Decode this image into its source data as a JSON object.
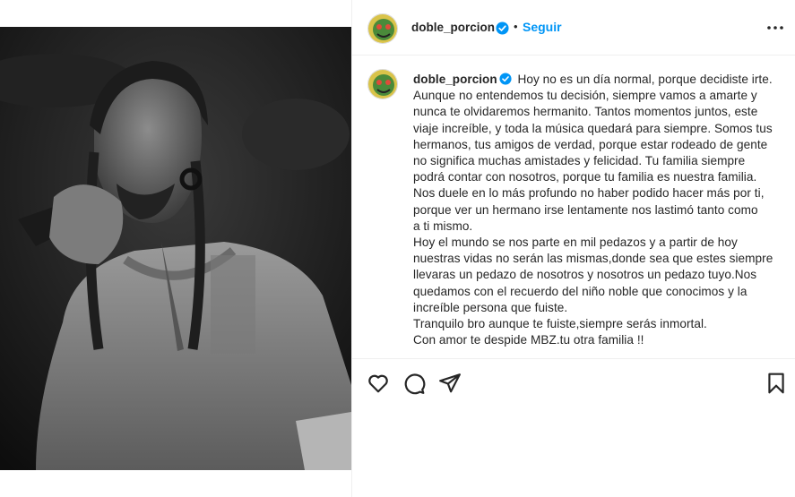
{
  "post": {
    "username": "doble_porcion",
    "follow_label": "Seguir",
    "dot": "•",
    "caption_lines": [
      "Aunque no entendemos tu decisión, siempre vamos a amarte y",
      "nunca te olvidaremos hermanito. Tantos momentos juntos, este",
      "viaje increíble, y toda la música quedará para siempre. Somos tus",
      "hermanos, tus amigos de verdad, porque estar rodeado de gente",
      "no significa muchas amistades y felicidad. Tu familia siempre",
      "podrá contar con nosotros, porque tu familia es nuestra familia.",
      "Nos duele en lo más profundo no haber podido hacer más por ti,",
      "porque ver un hermano irse lentamente nos lastimó tanto como",
      "a ti mismo.",
      "Hoy el mundo se nos parte en mil pedazos y a partir de hoy",
      "nuestras vidas no serán las mismas,donde sea que estes siempre",
      "llevaras un pedazo de nosotros y nosotros un pedazo tuyo.Nos",
      "quedamos con el recuerdo del niño noble que conocimos y la",
      "increíble persona que fuiste.",
      "Tranquilo bro aunque te fuiste,siempre serás inmortal.",
      "Con amor te despide MBZ.tu otra familia !!"
    ],
    "caption_first": "Hoy no es un día normal, porque decidiste irte."
  },
  "icons": {
    "verified": "verified-badge-icon",
    "more": "more-options-icon",
    "like": "heart-icon",
    "comment": "comment-icon",
    "share": "share-icon",
    "save": "bookmark-icon"
  },
  "colors": {
    "accent": "#0095f6",
    "text": "#262626",
    "border": "#efefef"
  }
}
